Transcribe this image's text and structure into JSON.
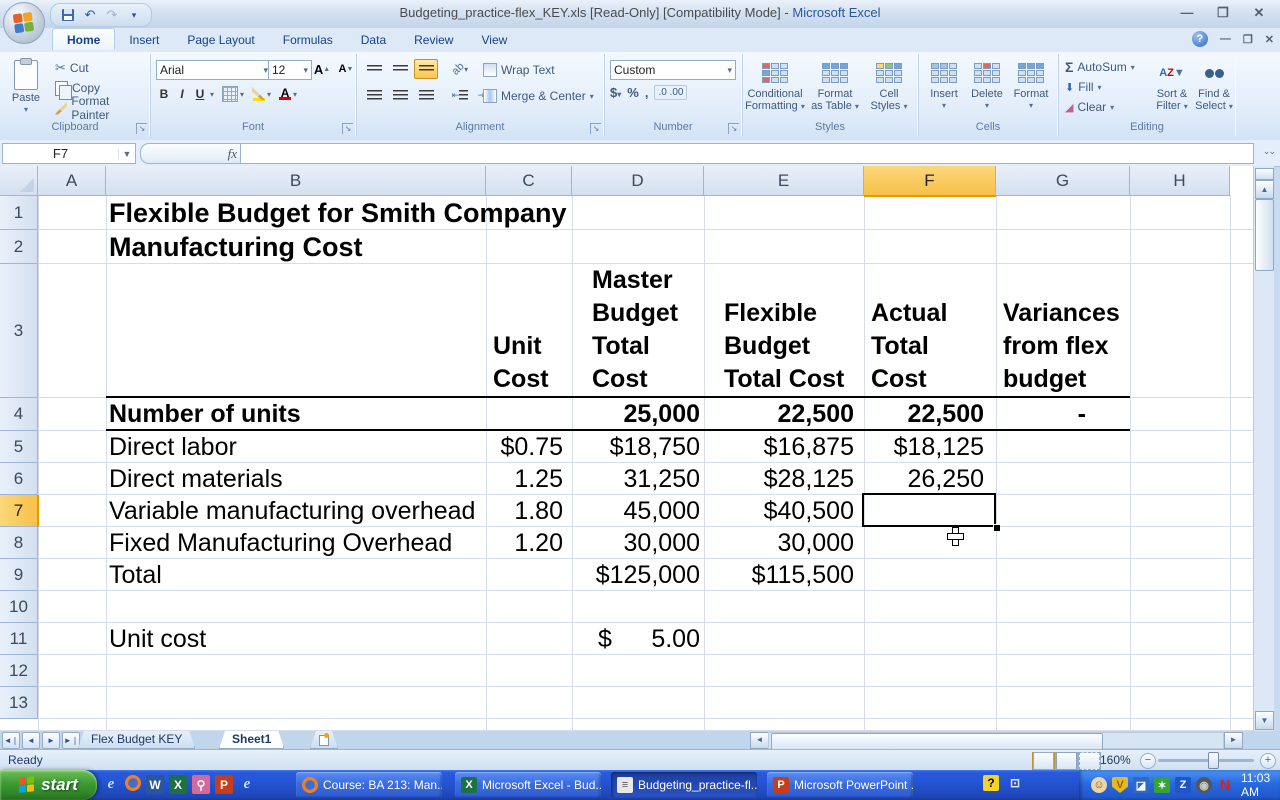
{
  "title_bar": {
    "title_left": "Budgeting_practice-flex_KEY.xls  [Read-Only]  [Compatibility Mode] -",
    "title_right": "Microsoft Excel"
  },
  "ribbon_tabs": [
    {
      "label": "Home",
      "active": true
    },
    {
      "label": "Insert"
    },
    {
      "label": "Page Layout"
    },
    {
      "label": "Formulas"
    },
    {
      "label": "Data"
    },
    {
      "label": "Review"
    },
    {
      "label": "View"
    }
  ],
  "ribbon": {
    "clipboard": {
      "group": "Clipboard",
      "paste": "Paste",
      "cut": "Cut",
      "copy": "Copy",
      "format_painter": "Format Painter"
    },
    "font": {
      "group": "Font",
      "font_name": "Arial",
      "font_size": "12",
      "bold": "B",
      "italic": "I",
      "underline": "U"
    },
    "alignment": {
      "group": "Alignment",
      "wrap_text": "Wrap Text",
      "merge_center": "Merge & Center"
    },
    "number": {
      "group": "Number",
      "format": "Custom",
      "currency": "$",
      "percent": "%",
      "comma": ",",
      "inc_dec": ".0 .00"
    },
    "styles": {
      "group": "Styles",
      "conditional_1": "Conditional",
      "conditional_2": "Formatting",
      "table_1": "Format",
      "table_2": "as Table",
      "cellstyles_1": "Cell",
      "cellstyles_2": "Styles"
    },
    "cells": {
      "group": "Cells",
      "insert": "Insert",
      "delete": "Delete",
      "format": "Format"
    },
    "editing": {
      "group": "Editing",
      "sigma": "Σ",
      "autosum": "AutoSum",
      "fill": "Fill",
      "clear": "Clear",
      "sort_1": "Sort &",
      "sort_2": "Filter",
      "find_1": "Find &",
      "find_2": "Select"
    }
  },
  "formula_bar": {
    "name_box": "F7",
    "fx": "fx",
    "value": ""
  },
  "grid": {
    "columns": [
      "A",
      "B",
      "C",
      "D",
      "E",
      "F",
      "G",
      "H"
    ],
    "rows": [
      "1",
      "2",
      "3",
      "4",
      "5",
      "6",
      "7",
      "8",
      "9",
      "10",
      "11",
      "12",
      "13"
    ],
    "selected_cell": "F7",
    "selected_column": "F",
    "selected_row": "7",
    "cells": [
      {
        "ref": "B1",
        "text": "Flexible Budget for Smith Company",
        "bold": true,
        "size": "title"
      },
      {
        "ref": "B2",
        "text": "Manufacturing Cost",
        "bold": true,
        "size": "title"
      },
      {
        "ref": "C3",
        "lines": [
          "Unit",
          "Cost"
        ],
        "bold": true
      },
      {
        "ref": "D3",
        "lines": [
          "Master",
          "Budget",
          "Total",
          "Cost"
        ],
        "bold": true,
        "indent": true
      },
      {
        "ref": "E3",
        "lines": [
          "Flexible",
          "Budget",
          "Total Cost"
        ],
        "bold": true,
        "indent": true
      },
      {
        "ref": "F3",
        "lines": [
          "Actual",
          "Total",
          "Cost"
        ],
        "bold": true
      },
      {
        "ref": "G3",
        "lines": [
          "Variances",
          "from flex",
          "budget"
        ],
        "bold": true
      },
      {
        "ref": "B4",
        "text": "Number of units",
        "bold": true
      },
      {
        "ref": "D4",
        "text": "25,000",
        "bold": true,
        "align": "right"
      },
      {
        "ref": "E4",
        "text": "22,500",
        "bold": true,
        "align": "right"
      },
      {
        "ref": "F4",
        "text": "22,500",
        "bold": true,
        "align": "right"
      },
      {
        "ref": "G4",
        "text": "-",
        "bold": true,
        "align": "right"
      },
      {
        "ref": "B5",
        "text": "Direct labor"
      },
      {
        "ref": "C5",
        "text": "$0.75",
        "align": "right"
      },
      {
        "ref": "D5",
        "text": "$18,750",
        "align": "right"
      },
      {
        "ref": "E5",
        "text": "$16,875",
        "align": "right"
      },
      {
        "ref": "F5",
        "text": "$18,125",
        "align": "right"
      },
      {
        "ref": "B6",
        "text": "Direct materials"
      },
      {
        "ref": "C6",
        "text": "1.25",
        "align": "right"
      },
      {
        "ref": "D6",
        "text": "31,250",
        "align": "right"
      },
      {
        "ref": "E6",
        "text": "$28,125",
        "align": "right"
      },
      {
        "ref": "F6",
        "text": "26,250",
        "align": "right"
      },
      {
        "ref": "B7",
        "text": "Variable manufacturing overhead"
      },
      {
        "ref": "C7",
        "text": "1.80",
        "align": "right"
      },
      {
        "ref": "D7",
        "text": "45,000",
        "align": "right"
      },
      {
        "ref": "E7",
        "text": "$40,500",
        "align": "right"
      },
      {
        "ref": "B8",
        "text": "Fixed Manufacturing Overhead"
      },
      {
        "ref": "C8",
        "text": "1.20",
        "align": "right"
      },
      {
        "ref": "D8",
        "text": "30,000",
        "align": "right"
      },
      {
        "ref": "E8",
        "text": "30,000",
        "align": "right"
      },
      {
        "ref": "B9",
        "text": "Total"
      },
      {
        "ref": "D9",
        "text": "$125,000",
        "align": "right"
      },
      {
        "ref": "E9",
        "text": "$115,500",
        "align": "right"
      },
      {
        "ref": "B11",
        "text": "Unit cost"
      },
      {
        "ref": "D11",
        "text": "5.00",
        "align": "right",
        "currency_left": "$"
      }
    ]
  },
  "sheet_tabs": [
    {
      "label": "Flex Budget KEY"
    },
    {
      "label": "Sheet1",
      "active": true
    }
  ],
  "status_bar": {
    "ready": "Ready",
    "zoom": "160%"
  },
  "taskbar": {
    "start_label": "start",
    "quick_launch": [
      {
        "name": "internet-explorer-icon",
        "glyph": "e",
        "bg": "transparent",
        "fg": "#bfe0ff"
      },
      {
        "name": "firefox-icon",
        "glyph": "",
        "bg": "radial-gradient(circle,#3b6fd4 40%,#f38020 45%)",
        "fg": "#fff"
      },
      {
        "name": "word-icon",
        "glyph": "W",
        "bg": "#2b579a",
        "fg": "#fff"
      },
      {
        "name": "excel-icon",
        "glyph": "X",
        "bg": "#1e7145",
        "fg": "#fff"
      },
      {
        "name": "key-icon",
        "glyph": "⚲",
        "bg": "#d46a9a",
        "fg": "#fff"
      },
      {
        "name": "powerpoint-icon",
        "glyph": "P",
        "bg": "#c43e1c",
        "fg": "#fff"
      },
      {
        "name": "internet-explorer-2-icon",
        "glyph": "e",
        "bg": "transparent",
        "fg": "#bfe0ff"
      }
    ],
    "buttons": [
      {
        "label": "Course: BA 213: Man...",
        "icon": "firefox-icon",
        "glyph": "",
        "iconbg": "radial-gradient(circle,#3b6fd4 40%,#f38020 45%)",
        "iconfg": "#fff",
        "pressed": false
      },
      {
        "label": "Microsoft Excel - Bud...",
        "icon": "excel-icon",
        "glyph": "X",
        "iconbg": "#1e7145",
        "iconfg": "#fff",
        "pressed": false
      },
      {
        "label": "Budgeting_practice-fl...",
        "icon": "document-icon",
        "glyph": "≡",
        "iconbg": "#e8e8e8",
        "iconfg": "#555",
        "pressed": true
      },
      {
        "label": "Microsoft PowerPoint ...",
        "icon": "powerpoint-icon",
        "glyph": "P",
        "iconbg": "#c43e1c",
        "iconfg": "#fff",
        "pressed": false
      }
    ],
    "extras": [
      {
        "name": "help-question-icon",
        "glyph": "?",
        "bg": "#f5d328",
        "fg": "#000"
      },
      {
        "name": "display-switch-icon",
        "glyph": "⊡",
        "bg": "transparent",
        "fg": "#dce8fa"
      }
    ],
    "tray": [
      {
        "name": "messenger-icon",
        "glyph": "☺",
        "bg": "#e8d5a8",
        "fg": "#7a5c20"
      },
      {
        "name": "antivirus-shield-icon",
        "glyph": "V",
        "bg": "#e8b820",
        "fg": "#8a6500"
      },
      {
        "name": "network-icon",
        "glyph": "◪",
        "bg": "#2f6ac1",
        "fg": "#fff"
      },
      {
        "name": "updates-icon",
        "glyph": "✶",
        "bg": "#35a435",
        "fg": "#fff"
      },
      {
        "name": "zone-icon",
        "glyph": "Z",
        "bg": "#2255c4",
        "fg": "#fff"
      },
      {
        "name": "volume-icon",
        "glyph": "◉",
        "bg": "#555",
        "fg": "#ccc"
      },
      {
        "name": "novell-icon",
        "glyph": "N",
        "bg": "transparent",
        "fg": "#d42020"
      }
    ],
    "time": "11:03 AM"
  }
}
